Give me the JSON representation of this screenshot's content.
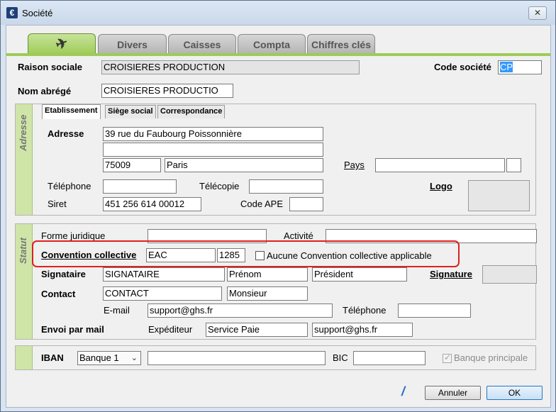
{
  "window": {
    "title": "Société",
    "close": "✕"
  },
  "tabs": [
    {
      "label": "",
      "icon": "airplane-icon"
    },
    {
      "label": "Divers"
    },
    {
      "label": "Caisses"
    },
    {
      "label": "Compta"
    },
    {
      "label": "Chiffres clés"
    }
  ],
  "header": {
    "raison_sociale_label": "Raison sociale",
    "raison_sociale_value": "CROISIERES PRODUCTION",
    "code_societe_label": "Code société",
    "code_societe_value": "CP",
    "nom_abrege_label": "Nom abrégé",
    "nom_abrege_value": "CROISIERES PRODUCTIO"
  },
  "adresse": {
    "side_label": "Adresse",
    "subtabs": [
      "Etablissement",
      "Siège social",
      "Correspondance"
    ],
    "adresse_label": "Adresse",
    "line1": "39 rue du Faubourg Poissonnière",
    "line2": "",
    "cp": "75009",
    "ville": "Paris",
    "pays_label": "Pays",
    "pays_value": "",
    "pays_code": "",
    "telephone_label": "Téléphone",
    "telephone_value": "",
    "telecopie_label": "Télécopie",
    "telecopie_value": "",
    "logo_label": "Logo",
    "siret_label": "Siret",
    "siret_value": "451 256 614 00012",
    "code_ape_label": "Code APE",
    "code_ape_value": ""
  },
  "statut": {
    "side_label": "Statut",
    "forme_juridique_label": "Forme juridique",
    "forme_juridique_value": "",
    "activite_label": "Activité",
    "activite_value": "",
    "convention_label": "Convention collective",
    "convention_code": "EAC",
    "convention_num": "1285",
    "aucune_label": "Aucune Convention collective applicable",
    "signataire_label": "Signataire",
    "signataire_nom": "SIGNATAIRE",
    "signataire_prenom": "Prénom",
    "signataire_fonction": "Président",
    "signature_label": "Signature",
    "contact_label": "Contact",
    "contact_nom": "CONTACT",
    "contact_civilite": "Monsieur",
    "email_label": "E-mail",
    "email_value": "support@ghs.fr",
    "telephone_label": "Téléphone",
    "telephone_value": "",
    "envoi_label": "Envoi par mail",
    "expediteur_label": "Expéditeur",
    "expediteur_nom": "Service Paie",
    "expediteur_email": "support@ghs.fr"
  },
  "banque": {
    "iban_label": "IBAN",
    "banque_select": "Banque 1",
    "iban_value": "",
    "bic_label": "BIC",
    "bic_value": "",
    "principale_label": "Banque principale",
    "principale_checked": true
  },
  "footer": {
    "annuler_label": "Annuler",
    "ok_label": "OK"
  },
  "colors": {
    "tab_active": "#9ecb57",
    "side_band": "#cfe5a8",
    "highlight": "#e02020"
  }
}
